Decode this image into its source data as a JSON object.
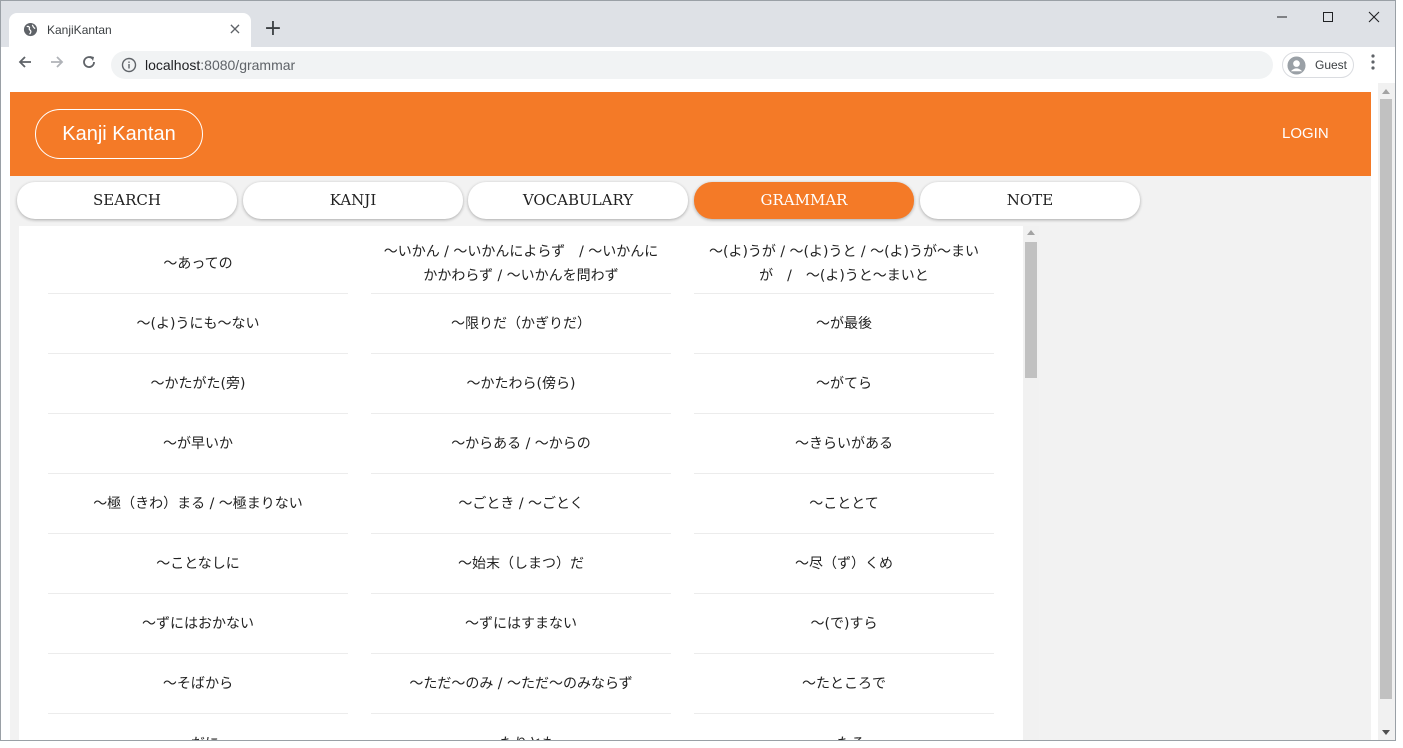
{
  "browser": {
    "tab_title": "KanjiKantan",
    "tab_close": "×",
    "new_tab": "+",
    "url_host": "localhost",
    "url_rest": ":8080/grammar",
    "profile_label": "Guest",
    "icons": [
      "globe-icon",
      "close-icon",
      "plus-icon",
      "back-icon",
      "forward-icon",
      "reload-icon",
      "info-icon",
      "avatar-icon",
      "menu-dots-icon",
      "minimize-icon",
      "maximize-icon",
      "window-close-icon"
    ]
  },
  "header": {
    "brand": "Kanji Kantan",
    "login": "LOGIN",
    "accent_color": "#f47a27"
  },
  "nav": {
    "tabs": [
      {
        "label": "SEARCH",
        "active": false
      },
      {
        "label": "KANJI",
        "active": false
      },
      {
        "label": "VOCABULARY",
        "active": false
      },
      {
        "label": "GRAMMAR",
        "active": true
      },
      {
        "label": "NOTE",
        "active": false
      }
    ]
  },
  "grammar": {
    "items": [
      "～あっての",
      "～いかん / ～いかんによらず　/ ～いかんにかかわらず / ～いかんを問わず",
      "〜(よ)うが / 〜(よ)うと / 〜(よ)うが～まいが　/　〜(よ)うと～まいと",
      "〜(よ)うにも～ない",
      "〜限りだ（かぎりだ）",
      "～が最後",
      "～かたがた(旁)",
      "～かたわら(傍ら)",
      "～がてら",
      "～が早いか",
      "～からある / ～からの",
      "～きらいがある",
      "〜極（きわ）まる / ～極まりない",
      "～ごとき / ～ごとく",
      "～こととて",
      "～ことなしに",
      "〜始末（しまつ）だ",
      "〜尽（ず）くめ",
      "～ずにはおかない",
      "～ずにはすまない",
      "〜(で)すら",
      "～そばから",
      "～ただ～のみ / ～ただ～のみならず",
      "～たところで",
      "～だに",
      "～たりとも",
      "～たる"
    ]
  }
}
